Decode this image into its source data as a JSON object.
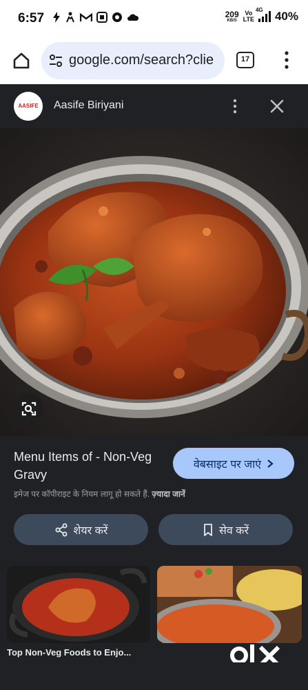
{
  "status": {
    "time": "6:57",
    "notif_icons": [
      "flash-icon",
      "person-walk-icon",
      "gmail-icon",
      "app-icon",
      "chrome-icon",
      "cloud-icon"
    ],
    "speed_value": "209",
    "speed_unit": "KB/S",
    "volte_top": "Vo",
    "volte_bottom": "LTE",
    "network": "4G",
    "battery": "40%"
  },
  "browser": {
    "url": "google.com/search?clie",
    "tab_count": "17"
  },
  "panel": {
    "logo_text": "AASIFE",
    "site_name": "Aasife Biriyani",
    "title": "Menu Items of - Non-Veg Gravy",
    "visit_label": "वेबसाइट पर जाएं",
    "copyright_text": "इमेज पर कॉपीराइट के नियम लागू हो सकते हैं.",
    "copyright_more": "ज़्यादा जानें",
    "share_label": "शेयर करें",
    "save_label": "सेव करें",
    "related_caption": "Top Non-Veg Foods to Enjo...",
    "watermark": "OLX"
  },
  "colors": {
    "panel_bg": "#202124",
    "accent_button": "#a8c7fa",
    "action_button": "#3c4a5c",
    "omnibox": "#e8eefb"
  }
}
